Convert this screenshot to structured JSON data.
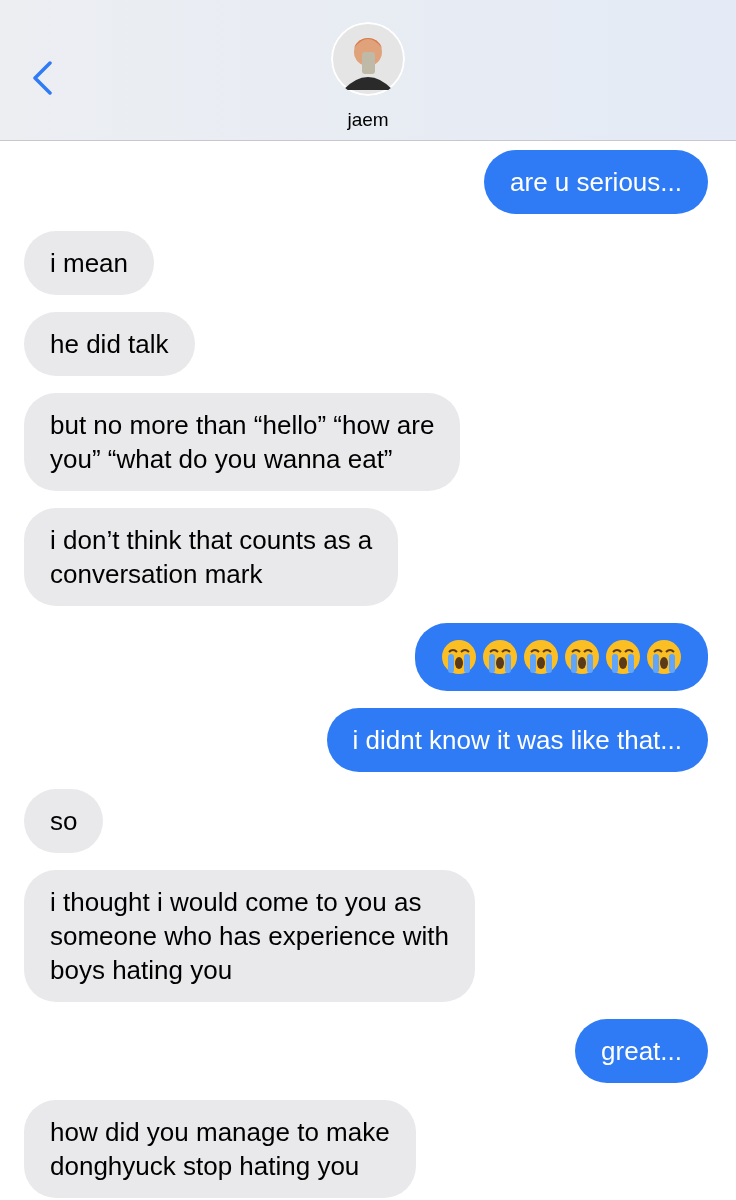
{
  "header": {
    "contact_name": "jaem"
  },
  "messages": [
    {
      "outgoing": true,
      "kind": "text",
      "lines": [
        "are u serious..."
      ]
    },
    {
      "outgoing": false,
      "kind": "text",
      "lines": [
        "i mean"
      ]
    },
    {
      "outgoing": false,
      "kind": "text",
      "lines": [
        "he did talk"
      ]
    },
    {
      "outgoing": false,
      "kind": "text",
      "lines": [
        "but no more than “hello” “how are",
        "you” “what do you wanna eat”"
      ]
    },
    {
      "outgoing": false,
      "kind": "text",
      "lines": [
        "i don’t think that counts as a",
        "conversation mark"
      ]
    },
    {
      "outgoing": true,
      "kind": "emoji",
      "emojis": [
        {
          "kind": "crying"
        },
        {
          "kind": "crying"
        },
        {
          "kind": "crying"
        },
        {
          "kind": "crying"
        },
        {
          "kind": "crying"
        },
        {
          "kind": "crying"
        }
      ]
    },
    {
      "outgoing": true,
      "kind": "text",
      "lines": [
        "i didnt know it was like that..."
      ]
    },
    {
      "outgoing": false,
      "kind": "text",
      "lines": [
        "so"
      ]
    },
    {
      "outgoing": false,
      "kind": "text",
      "lines": [
        "i thought i would come to you as",
        "someone who has experience with",
        "boys hating you"
      ]
    },
    {
      "outgoing": true,
      "kind": "text",
      "lines": [
        "great..."
      ]
    },
    {
      "outgoing": false,
      "kind": "text",
      "lines": [
        "how did you manage to make",
        "donghyuck stop hating you"
      ]
    }
  ]
}
